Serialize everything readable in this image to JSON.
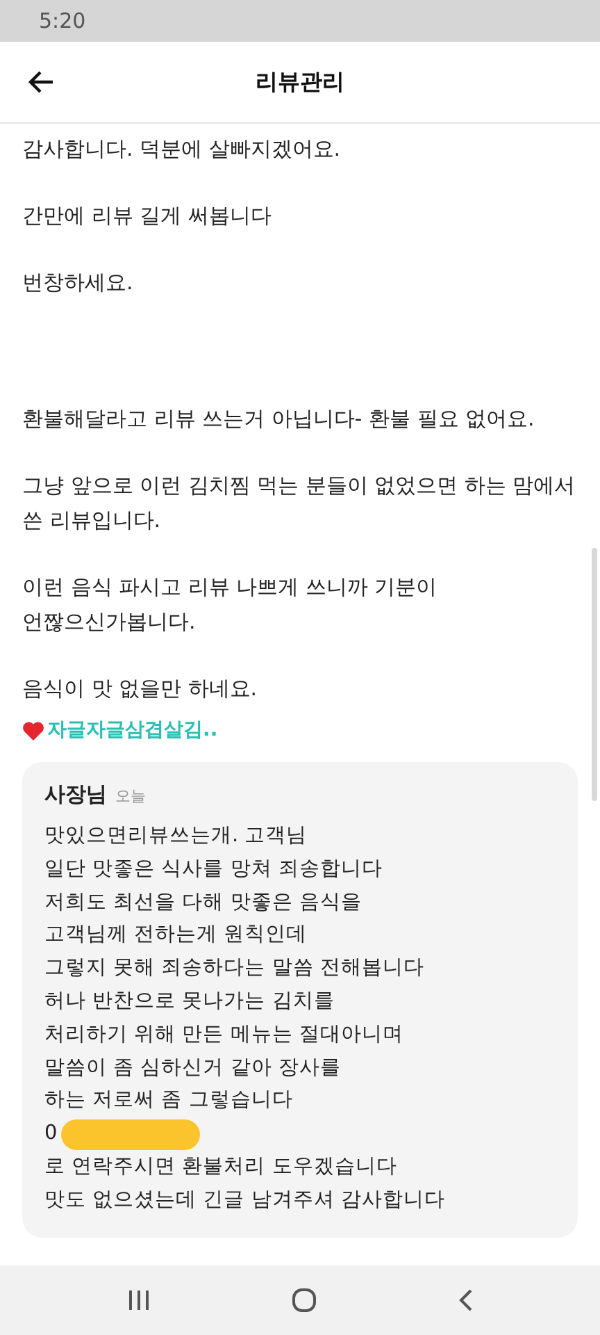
{
  "status_bar": {
    "time": "5:20"
  },
  "header": {
    "title": "리뷰관리"
  },
  "review": {
    "paragraphs": [
      {
        "lines": [
          "감사합니다. 덕분에 살빠지겠어요."
        ]
      },
      {
        "lines": [
          "간만에 리뷰 길게 써봅니다"
        ]
      },
      {
        "lines": [
          "번창하세요."
        ]
      },
      {
        "lines": [
          "환불해달라고 리뷰 쓰는거 아닙니다- 환불 필요 없어요."
        ]
      },
      {
        "lines": [
          "그냥 앞으로 이런 김치찜 먹는 분들이 없었으면 하는 맘에서",
          "쓴 리뷰입니다."
        ]
      },
      {
        "lines": [
          "이런 음식 파시고 리뷰 나쁘게 쓰니까 기분이",
          "언짢으신가봅니다."
        ]
      },
      {
        "lines": [
          "음식이 맛 없을만 하네요."
        ]
      }
    ],
    "author": "자글자글삼겹살김.."
  },
  "reply": {
    "author": "사장님",
    "date": "오늘",
    "lines": [
      {
        "text": "맛있으면리뷰쓰는개. 고객님",
        "redacted": false
      },
      {
        "text": "일단 맛좋은 식사를 망쳐 죄송합니다",
        "redacted": false
      },
      {
        "text": "저희도 최선을 다해 맛좋은 음식을",
        "redacted": false
      },
      {
        "text": "고객님께 전하는게 원칙인데",
        "redacted": false
      },
      {
        "text": "그렇지 못해 죄송하다는 말씀 전해봅니다",
        "redacted": false
      },
      {
        "text": "허나 반찬으로 못나가는 김치를",
        "redacted": false
      },
      {
        "text": "처리하기 위해 만든 메뉴는 절대아니며",
        "redacted": false
      },
      {
        "text": "말씀이 좀 심하신거 같아 장사를",
        "redacted": false
      },
      {
        "text": "하는 저로써 좀 그렇습니다",
        "redacted": false
      },
      {
        "text": "0",
        "redacted": true
      },
      {
        "text": "로 연락주시면 환불처리 도우겠습니다",
        "redacted": false
      },
      {
        "text": "맛도 없으셨는데 긴글 남겨주셔 감사합니다",
        "redacted": false
      }
    ]
  }
}
